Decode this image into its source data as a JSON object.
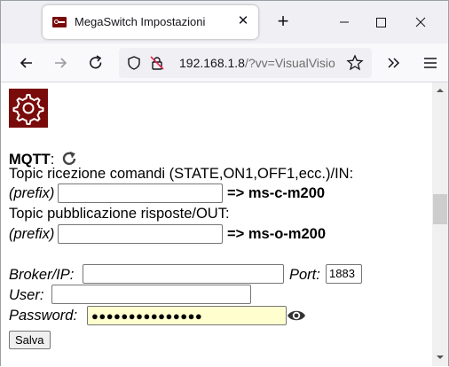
{
  "browser": {
    "tab_title": "MegaSwitch Impostazioni",
    "tab_close": "✕",
    "new_tab": "+",
    "url_host": "192.168.1.8",
    "url_rest": "/?vv=VisualVisio",
    "icons": [
      "back-icon",
      "forward-icon",
      "reload-icon",
      "shield-icon",
      "insecure-lock-icon",
      "bookmark-star-icon",
      "overflow-chevrons-icon",
      "hamburger-menu-icon"
    ]
  },
  "page": {
    "logo_icon": "gear-icon",
    "logo_color": "#7a0b0b",
    "mqtt_label": "MQTT",
    "mqtt_colon": ":",
    "topic_in_label": "Topic ricezione comandi (STATE,ON1,OFF1,ecc.)/IN:",
    "prefix_label_1": "(prefix)",
    "topic_in_arrow": "=>",
    "topic_in_value": "ms-c-m200",
    "topic_out_label": "Topic pubblicazione risposte/OUT:",
    "prefix_label_2": "(prefix)",
    "topic_out_arrow": "=>",
    "topic_out_value": "ms-o-m200",
    "broker_label": "Broker/IP:",
    "port_label": "Port:",
    "port_value": "1883",
    "user_label": "User:",
    "password_label": "Password:",
    "password_masked": "●●●●●●●●●●●●●●●",
    "save_label": "Salva"
  }
}
